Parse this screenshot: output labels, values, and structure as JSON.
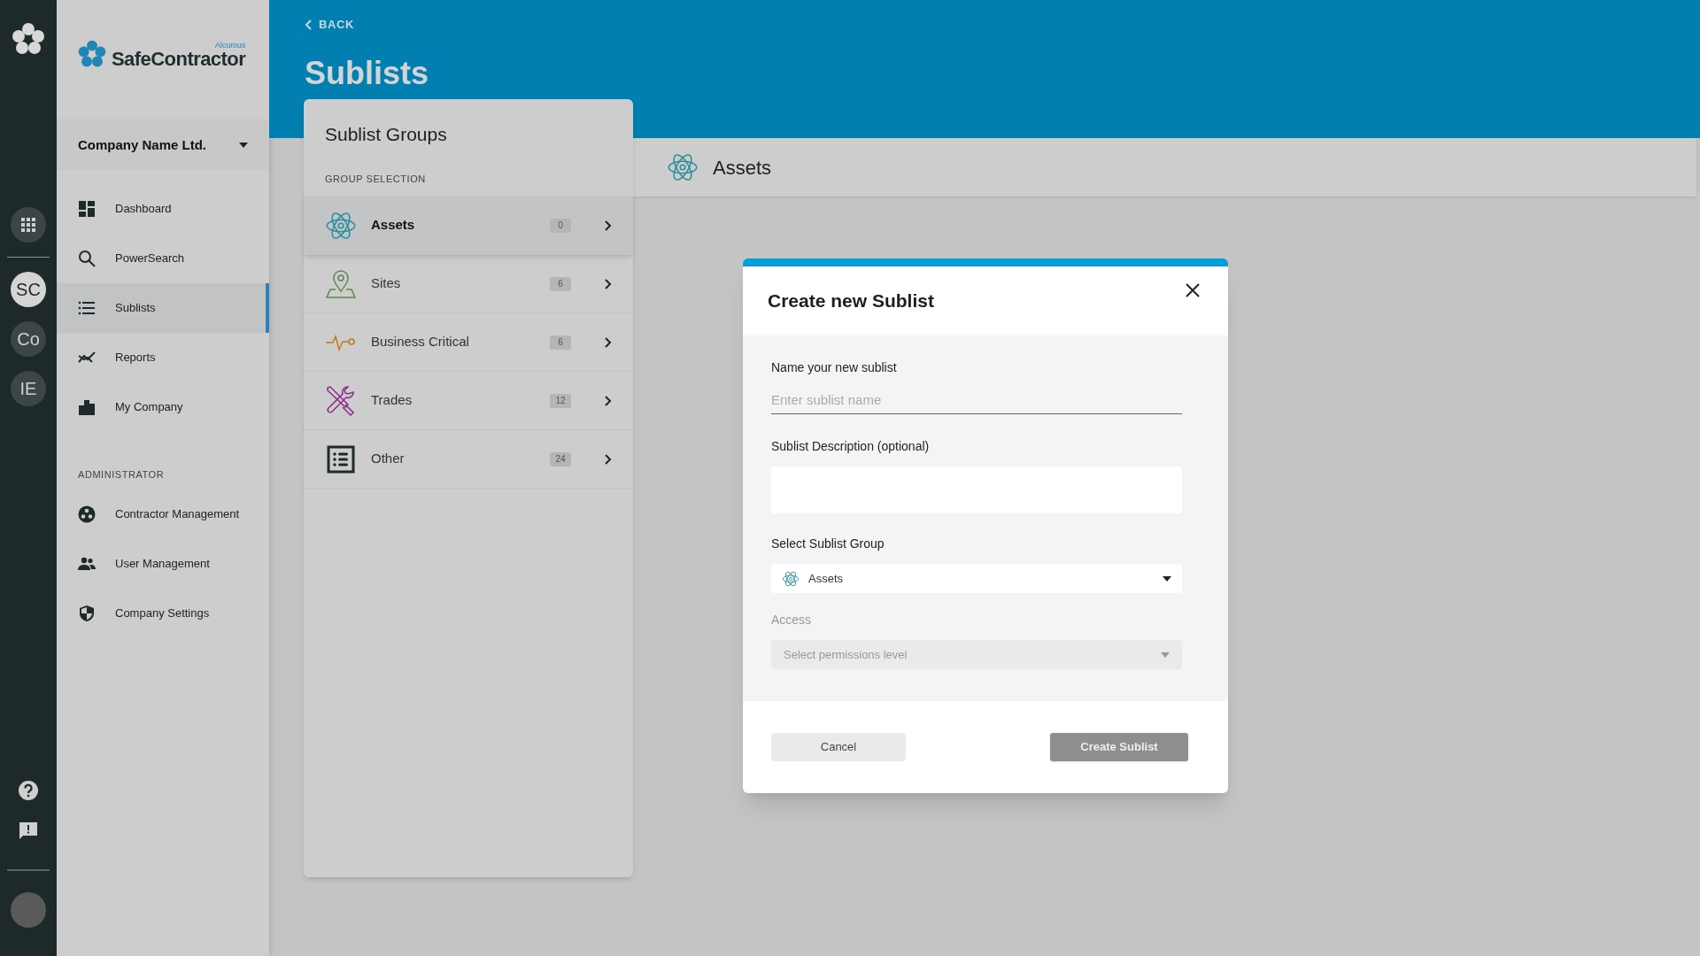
{
  "rail": {
    "avatars": [
      {
        "label": "SC",
        "selected": true
      },
      {
        "label": "Co",
        "selected": false
      },
      {
        "label": "IE",
        "selected": false
      }
    ]
  },
  "sidebar": {
    "brand_small": "Alcumus",
    "brand": "SafeContractor",
    "company": "Company Name Ltd.",
    "items": [
      {
        "kind": "dashboard",
        "label": "Dashboard",
        "selected": false
      },
      {
        "kind": "search",
        "label": "PowerSearch",
        "selected": false
      },
      {
        "kind": "list",
        "label": "Sublists",
        "selected": true
      },
      {
        "kind": "reports",
        "label": "Reports",
        "selected": false
      },
      {
        "kind": "company",
        "label": "My Company",
        "selected": false
      }
    ],
    "admin_heading": "ADMINISTRATOR",
    "admin_items": [
      {
        "kind": "contractors",
        "label": "Contractor Management",
        "selected": false
      },
      {
        "kind": "users",
        "label": "User Management",
        "selected": false
      },
      {
        "kind": "shield",
        "label": "Company Settings",
        "selected": false
      }
    ]
  },
  "header": {
    "back": "BACK",
    "title": "Sublists"
  },
  "groups": {
    "title": "Sublist Groups",
    "section_label": "GROUP SELECTION",
    "items": [
      {
        "kind": "assets",
        "label": "Assets",
        "count": "0",
        "selected": true,
        "color": "#2a8fa0"
      },
      {
        "kind": "sites",
        "label": "Sites",
        "count": "6",
        "selected": false,
        "color": "#5a8a4a"
      },
      {
        "kind": "critical",
        "label": "Business Critical",
        "count": "6",
        "selected": false,
        "color": "#c07a1a"
      },
      {
        "kind": "trades",
        "label": "Trades",
        "count": "12",
        "selected": false,
        "color": "#8a2a8a"
      },
      {
        "kind": "other",
        "label": "Other",
        "count": "24",
        "selected": false,
        "color": "#1f2a2a"
      }
    ]
  },
  "content_header": {
    "title": "Assets"
  },
  "modal": {
    "title": "Create new Sublist",
    "name_field": {
      "label": "Name your new sublist",
      "placeholder": "Enter sublist name"
    },
    "description_field": {
      "label": "Sublist Description (optional)"
    },
    "group_field": {
      "label": "Select Sublist Group",
      "value": "Assets"
    },
    "access_field": {
      "label": "Access",
      "placeholder": "Select permissions level",
      "disabled": true
    },
    "cancel": "Cancel",
    "create": {
      "label": "Create Sublist",
      "disabled": true
    }
  }
}
